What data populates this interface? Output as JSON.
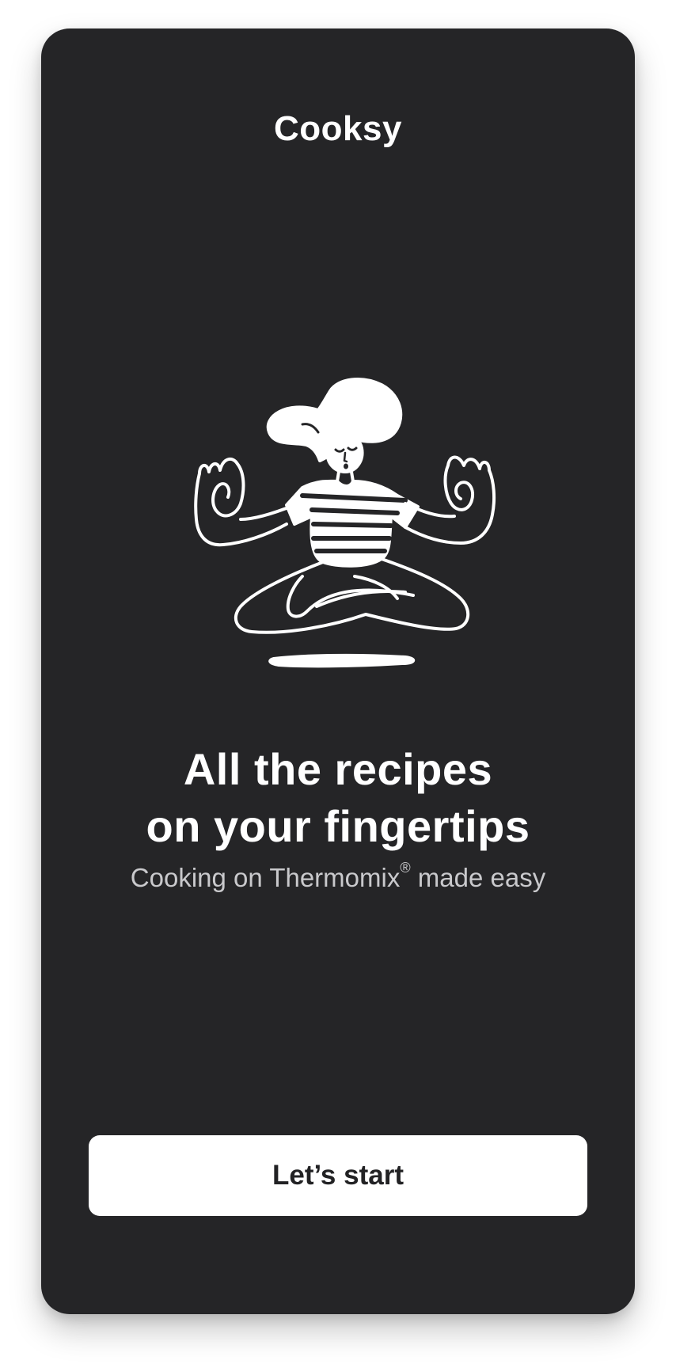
{
  "app": {
    "title": "Cooksy"
  },
  "hero": {
    "headline_line1": "All the recipes",
    "headline_line2": "on your fingertips",
    "subtitle_before": "Cooking on Thermomix",
    "subtitle_mark": "®",
    "subtitle_after": " made easy",
    "illustration": "meditating-person-illustration"
  },
  "actions": {
    "start_label": "Let’s start"
  },
  "colors": {
    "card_background": "#252527",
    "page_background": "#ffffff",
    "text_primary": "#ffffff",
    "text_secondary": "#c9c9cc",
    "button_background": "#ffffff",
    "button_text": "#222224"
  }
}
